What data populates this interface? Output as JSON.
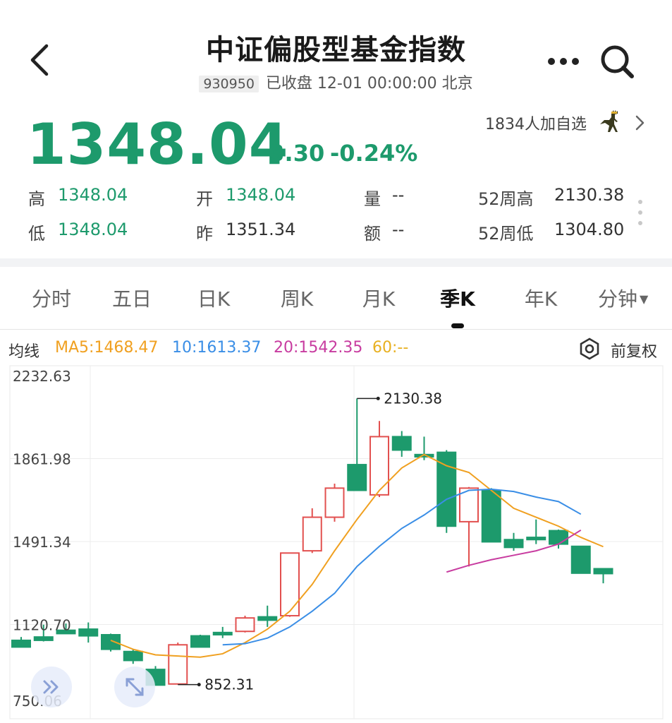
{
  "header": {
    "title": "中证偏股型基金指数",
    "code": "930950",
    "status": "已收盘 12-01 00:00:00 北京"
  },
  "quote": {
    "price": "1348.04",
    "change": "-3.30",
    "change_pct": "-0.24%",
    "watchers": "1834人加自选",
    "stats": {
      "high_label": "高",
      "high": "1348.04",
      "low_label": "低",
      "low": "1348.04",
      "open_label": "开",
      "open": "1348.04",
      "prev_label": "昨",
      "prev": "1351.34",
      "vol_label": "量",
      "vol": "--",
      "amt_label": "额",
      "amt": "--",
      "w52h_label": "52周高",
      "w52h": "2130.38",
      "w52l_label": "52周低",
      "w52l": "1304.80"
    }
  },
  "tabs": [
    {
      "label": "分时",
      "active": false
    },
    {
      "label": "五日",
      "active": false
    },
    {
      "label": "日K",
      "active": false
    },
    {
      "label": "周K",
      "active": false
    },
    {
      "label": "月K",
      "active": false
    },
    {
      "label": "季K",
      "active": true
    },
    {
      "label": "年K",
      "active": false
    },
    {
      "label": "分钟",
      "active": false
    }
  ],
  "ma_legend": {
    "title": "均线",
    "ma5": "MA5:1468.47",
    "ma10": "10:1613.37",
    "ma20": "20:1542.35",
    "ma60": "60:--",
    "adjust": "前复权"
  },
  "colors": {
    "up": "#e2504f",
    "down": "#1d9a6c",
    "ma5": "#f0a020",
    "ma10": "#3a8ee6",
    "ma20": "#c83ca0",
    "ma60": "#e8b020"
  },
  "icons": [
    "back-icon",
    "more-icon",
    "search-icon",
    "dino-icon",
    "chevron-right-icon",
    "vertical-dots-icon",
    "adjust-icon",
    "fast-forward-icon",
    "expand-icon"
  ],
  "chart_data": {
    "type": "candlestick",
    "y_ticks": [
      "2232.63",
      "1861.98",
      "1491.34",
      "1120.70",
      "750.06"
    ],
    "ylim": [
      750.06,
      2232.63
    ],
    "grid": true,
    "annotations": [
      {
        "label": "2130.38",
        "candle_index": 15,
        "value": 2130.38
      },
      {
        "label": "852.31",
        "candle_index": 7,
        "value": 852.31
      }
    ],
    "candles": [
      {
        "o": 1050,
        "h": 1065,
        "l": 1030,
        "c": 1020
      },
      {
        "o": 1065,
        "h": 1120,
        "l": 1045,
        "c": 1050
      },
      {
        "o": 1095,
        "h": 1125,
        "l": 1085,
        "c": 1080
      },
      {
        "o": 1100,
        "h": 1130,
        "l": 1040,
        "c": 1070
      },
      {
        "o": 1075,
        "h": 1080,
        "l": 1000,
        "c": 1010
      },
      {
        "o": 1000,
        "h": 1010,
        "l": 945,
        "c": 960
      },
      {
        "o": 920,
        "h": 935,
        "l": 852.31,
        "c": 850
      },
      {
        "o": 855,
        "h": 1040,
        "l": 852.31,
        "c": 1030
      },
      {
        "o": 1070,
        "h": 1075,
        "l": 1020,
        "c": 1020
      },
      {
        "o": 1085,
        "h": 1110,
        "l": 1060,
        "c": 1075
      },
      {
        "o": 1090,
        "h": 1160,
        "l": 1085,
        "c": 1150
      },
      {
        "o": 1155,
        "h": 1205,
        "l": 1110,
        "c": 1140
      },
      {
        "o": 1160,
        "h": 1390,
        "l": 1155,
        "c": 1440
      },
      {
        "o": 1450,
        "h": 1640,
        "l": 1440,
        "c": 1600
      },
      {
        "o": 1600,
        "h": 1750,
        "l": 1580,
        "c": 1730
      },
      {
        "o": 1835,
        "h": 2130.38,
        "l": 1780,
        "c": 1720
      },
      {
        "o": 1700,
        "h": 2030,
        "l": 1690,
        "c": 1960
      },
      {
        "o": 1960,
        "h": 1985,
        "l": 1870,
        "c": 1900
      },
      {
        "o": 1880,
        "h": 1960,
        "l": 1855,
        "c": 1870
      },
      {
        "o": 1890,
        "h": 1900,
        "l": 1530,
        "c": 1560
      },
      {
        "o": 1580,
        "h": 1735,
        "l": 1380,
        "c": 1730
      },
      {
        "o": 1720,
        "h": 1730,
        "l": 1490,
        "c": 1490
      },
      {
        "o": 1500,
        "h": 1530,
        "l": 1450,
        "c": 1465
      },
      {
        "o": 1510,
        "h": 1590,
        "l": 1480,
        "c": 1500
      },
      {
        "o": 1540,
        "h": 1545,
        "l": 1460,
        "c": 1480
      },
      {
        "o": 1470,
        "h": 1470,
        "l": 1350,
        "c": 1350
      },
      {
        "o": 1370,
        "h": 1370,
        "l": 1304.8,
        "c": 1348.04
      }
    ],
    "ma5": [
      [
        4,
        1050
      ],
      [
        5,
        1010
      ],
      [
        6,
        985
      ],
      [
        7,
        980
      ],
      [
        8,
        975
      ],
      [
        9,
        990
      ],
      [
        10,
        1040
      ],
      [
        11,
        1100
      ],
      [
        12,
        1180
      ],
      [
        13,
        1300
      ],
      [
        14,
        1450
      ],
      [
        15,
        1590
      ],
      [
        16,
        1720
      ],
      [
        17,
        1820
      ],
      [
        18,
        1880
      ],
      [
        19,
        1830
      ],
      [
        20,
        1800
      ],
      [
        21,
        1720
      ],
      [
        22,
        1640
      ],
      [
        23,
        1600
      ],
      [
        24,
        1560
      ],
      [
        25,
        1510
      ],
      [
        26,
        1468.47
      ]
    ],
    "ma10": [
      [
        9,
        1030
      ],
      [
        10,
        1035
      ],
      [
        11,
        1060
      ],
      [
        12,
        1110
      ],
      [
        13,
        1180
      ],
      [
        14,
        1260
      ],
      [
        15,
        1380
      ],
      [
        16,
        1470
      ],
      [
        17,
        1550
      ],
      [
        18,
        1610
      ],
      [
        19,
        1680
      ],
      [
        20,
        1720
      ],
      [
        21,
        1725
      ],
      [
        22,
        1715
      ],
      [
        23,
        1690
      ],
      [
        24,
        1670
      ],
      [
        25,
        1613.37
      ]
    ],
    "ma20": [
      [
        19,
        1355
      ],
      [
        20,
        1385
      ],
      [
        21,
        1410
      ],
      [
        22,
        1430
      ],
      [
        23,
        1450
      ],
      [
        24,
        1480
      ],
      [
        25,
        1542.35
      ]
    ]
  }
}
